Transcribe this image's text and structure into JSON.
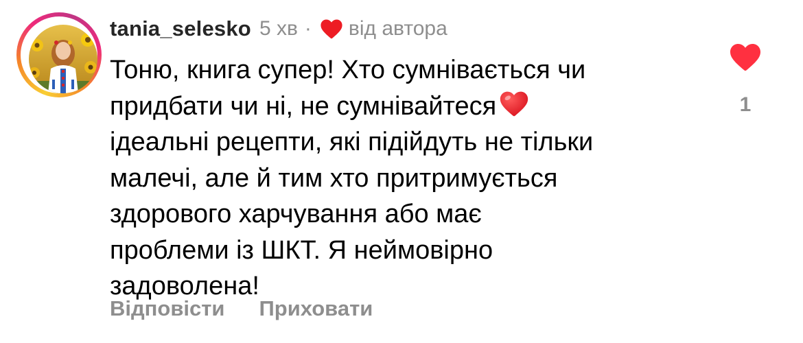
{
  "comment": {
    "username": "tania_selesko",
    "time": "5 хв",
    "separator": "·",
    "author_badge": {
      "icon": "heart-icon",
      "color": "#ed1c24",
      "label": "від автора"
    },
    "text_lines": [
      "Тоню, книга супер! Хто сумнівається чи",
      "придбати чи ні, не сумнівайтеся",
      "ідеальні рецепти, які підійдуть не тільки",
      "малечі, але й тим хто притримується",
      "здорового харчування або має",
      "проблеми із ШКТ. Я неймовірно",
      "задоволена!"
    ],
    "emoji": "red-heart-emoji",
    "actions": {
      "reply": "Відповісти",
      "hide": "Приховати"
    },
    "likes": {
      "icon": "heart-icon",
      "liked": true,
      "color": "#ff3040",
      "count": "1"
    },
    "avatar_ring_colors": [
      "#f9ce34",
      "#ee2a7b",
      "#c13584"
    ]
  }
}
